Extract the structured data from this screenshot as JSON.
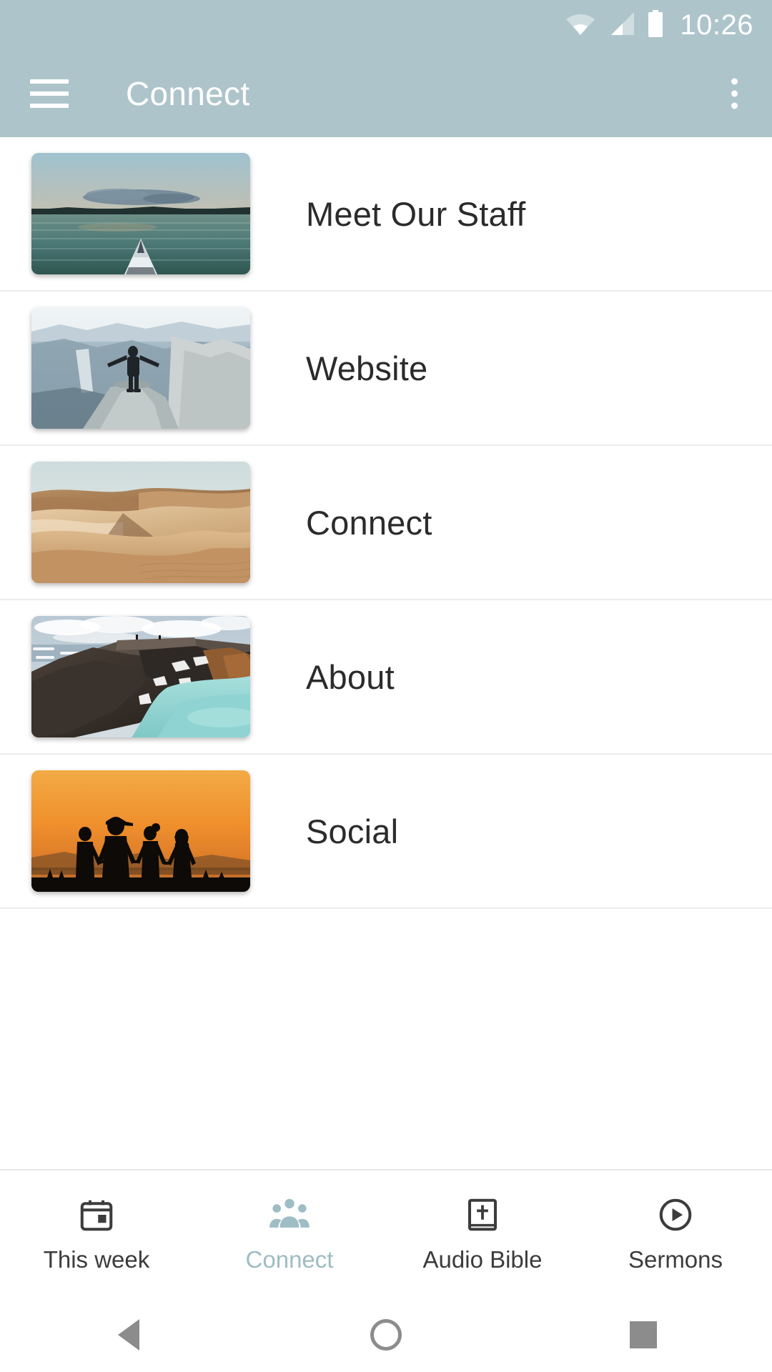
{
  "status_bar": {
    "time": "10:26",
    "icons": [
      "wifi-icon",
      "cellular-signal-icon",
      "battery-icon"
    ]
  },
  "app_bar": {
    "menu_icon": "hamburger-menu-icon",
    "title": "Connect",
    "overflow_icon": "overflow-menu-icon"
  },
  "list": {
    "items": [
      {
        "label": "Meet Our Staff",
        "thumbnail": "kayak-on-lake-at-sunset",
        "colors": {
          "sky_top": "#9fc2cf",
          "sky_glow": "#e7a96a",
          "water": "#4e7a78",
          "land": "#20312f"
        }
      },
      {
        "label": "Website",
        "thumbnail": "person-on-cliff-overlooking-valley",
        "colors": {
          "sky": "#e8eef1",
          "far_ridge": "#b5c6d0",
          "valley": "#8ca2ae",
          "rock": "#c8cfce",
          "figure": "#1f2429"
        }
      },
      {
        "label": "Connect",
        "thumbnail": "desert-sand-dunes",
        "colors": {
          "sky": "#d6e1e2",
          "dune_light": "#e3c49d",
          "dune_mid": "#c8a077",
          "dune_dark": "#8a6343"
        }
      },
      {
        "label": "About",
        "thumbnail": "volcanic-crater-lake",
        "colors": {
          "sky": "#c7d2da",
          "clouds": "#ffffff",
          "rock": "#403630",
          "rock_dark": "#2a241f",
          "lake": "#8fd4d2",
          "rust": "#9b6233"
        }
      },
      {
        "label": "Social",
        "thumbnail": "family-silhouettes-at-sunset",
        "colors": {
          "sky_top": "#f0a33a",
          "sky_mid": "#f0892a",
          "horizon": "#b8722e",
          "ground": "#110c08",
          "figures": "#0d0a07"
        }
      }
    ]
  },
  "bottom_nav": {
    "active_color": "#9ebdc4",
    "inactive_color": "#3c3c3c",
    "tabs": [
      {
        "label": "This week",
        "icon": "calendar-icon",
        "active": false
      },
      {
        "label": "Connect",
        "icon": "people-group-icon",
        "active": true
      },
      {
        "label": "Audio Bible",
        "icon": "bible-book-icon",
        "active": false
      },
      {
        "label": "Sermons",
        "icon": "play-circle-icon",
        "active": false
      }
    ]
  },
  "system_nav": {
    "back": "back-triangle-icon",
    "home": "home-circle-icon",
    "recents": "recents-square-icon"
  }
}
